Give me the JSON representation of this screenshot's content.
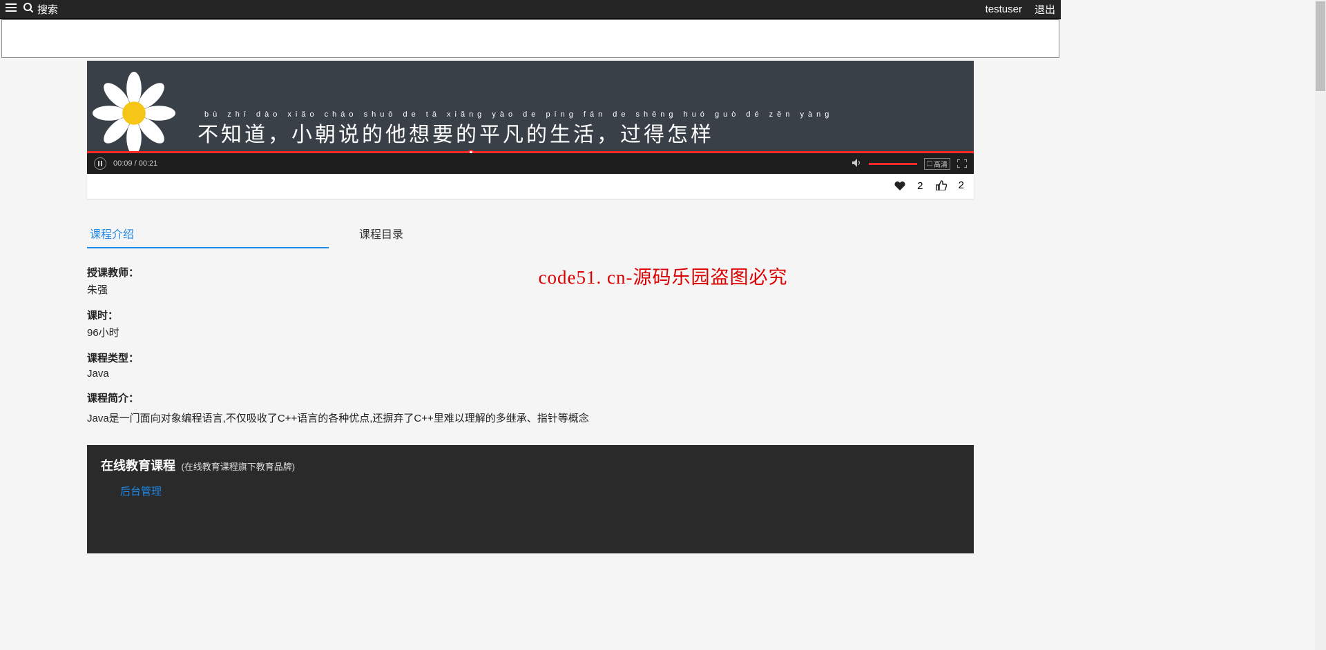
{
  "topbar": {
    "search_label": "搜索",
    "username": "testuser",
    "logout": "退出"
  },
  "video": {
    "pinyin": "bù   zhī   dào            xiǎo  cháo  shuō   de    tā   xiǎng  yào   de   píng   fán   de  shēng  huó            guò   dé   zěn  yàng",
    "lyrics": "不知道，小朝说的他想要的平凡的生活，过得怎样",
    "time_current": "00:09",
    "time_total": "00:21",
    "quality": "高清"
  },
  "stats": {
    "favorites": "2",
    "likes": "2"
  },
  "tabs": {
    "intro": "课程介绍",
    "toc": "课程目录"
  },
  "fields": {
    "teacher_label": "授课教师：",
    "teacher_value": "朱强",
    "hours_label": "课时：",
    "hours_value": "96小时",
    "type_label": "课程类型：",
    "type_value": "Java",
    "desc_label": "课程简介：",
    "desc_value": "Java是一门面向对象编程语言,不仅吸收了C++语言的各种优点,还摒弃了C++里难以理解的多继承、指针等概念"
  },
  "watermark": "code51. cn-源码乐园盗图必究",
  "footer": {
    "title": "在线教育课程",
    "subtitle": "(在线教育课程旗下教育品牌)",
    "admin_link": "后台管理"
  }
}
